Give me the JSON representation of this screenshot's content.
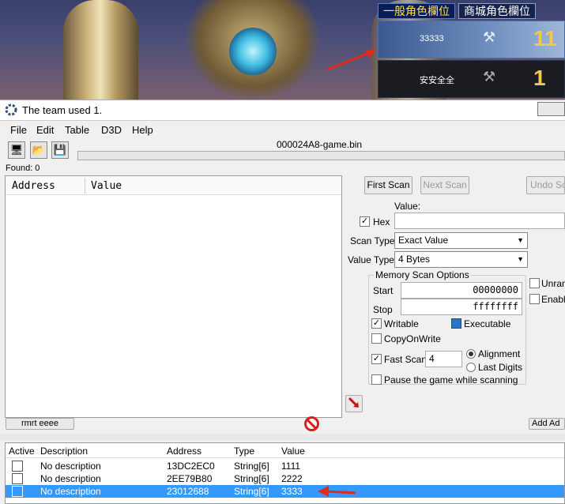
{
  "game": {
    "tabs": [
      "一般角色欄位",
      "商城角色欄位"
    ],
    "slots": [
      {
        "name": "33333",
        "level": "11"
      },
      {
        "name": "安安全全",
        "level": "1"
      }
    ]
  },
  "window": {
    "title": "The team used 1.",
    "menu": [
      "File",
      "Edit",
      "Table",
      "D3D",
      "Help"
    ],
    "process": "000024A8-game.bin",
    "found": "Found: 0"
  },
  "results_list": {
    "columns": [
      "Address",
      "Value"
    ]
  },
  "scan": {
    "first_scan": "First Scan",
    "next_scan": "Next Scan",
    "undo_scan": "Undo Scan",
    "value_label": "Value:",
    "value": "",
    "hex_label": "Hex",
    "scan_type_label": "Scan Type",
    "scan_type": "Exact Value",
    "value_type_label": "Value Type",
    "value_type": "4 Bytes",
    "memory_options_title": "Memory Scan Options",
    "start_label": "Start",
    "start": "00000000",
    "stop_label": "Stop",
    "stop": "ffffffff",
    "writable": "Writable",
    "executable": "Executable",
    "copyonwrite": "CopyOnWrite",
    "fast_scan": "Fast Scan",
    "fast_scan_value": "4",
    "alignment": "Alignment",
    "last_digits": "Last Digits",
    "pause": "Pause the game while scanning",
    "unrandomizer": "Unran",
    "enable_speedhack": "Enable"
  },
  "buttons": {
    "memory_view": "rmrt eeee",
    "add_address": "Add Ad"
  },
  "address_table": {
    "columns": [
      "Active",
      "Description",
      "Address",
      "Type",
      "Value"
    ],
    "rows": [
      {
        "description": "No description",
        "address": "13DC2EC0",
        "type": "String[6]",
        "value": "1111"
      },
      {
        "description": "No description",
        "address": "2EE79B80",
        "type": "String[6]",
        "value": "2222"
      },
      {
        "description": "No description",
        "address": "23012688",
        "type": "String[6]",
        "value": "3333"
      }
    ]
  }
}
